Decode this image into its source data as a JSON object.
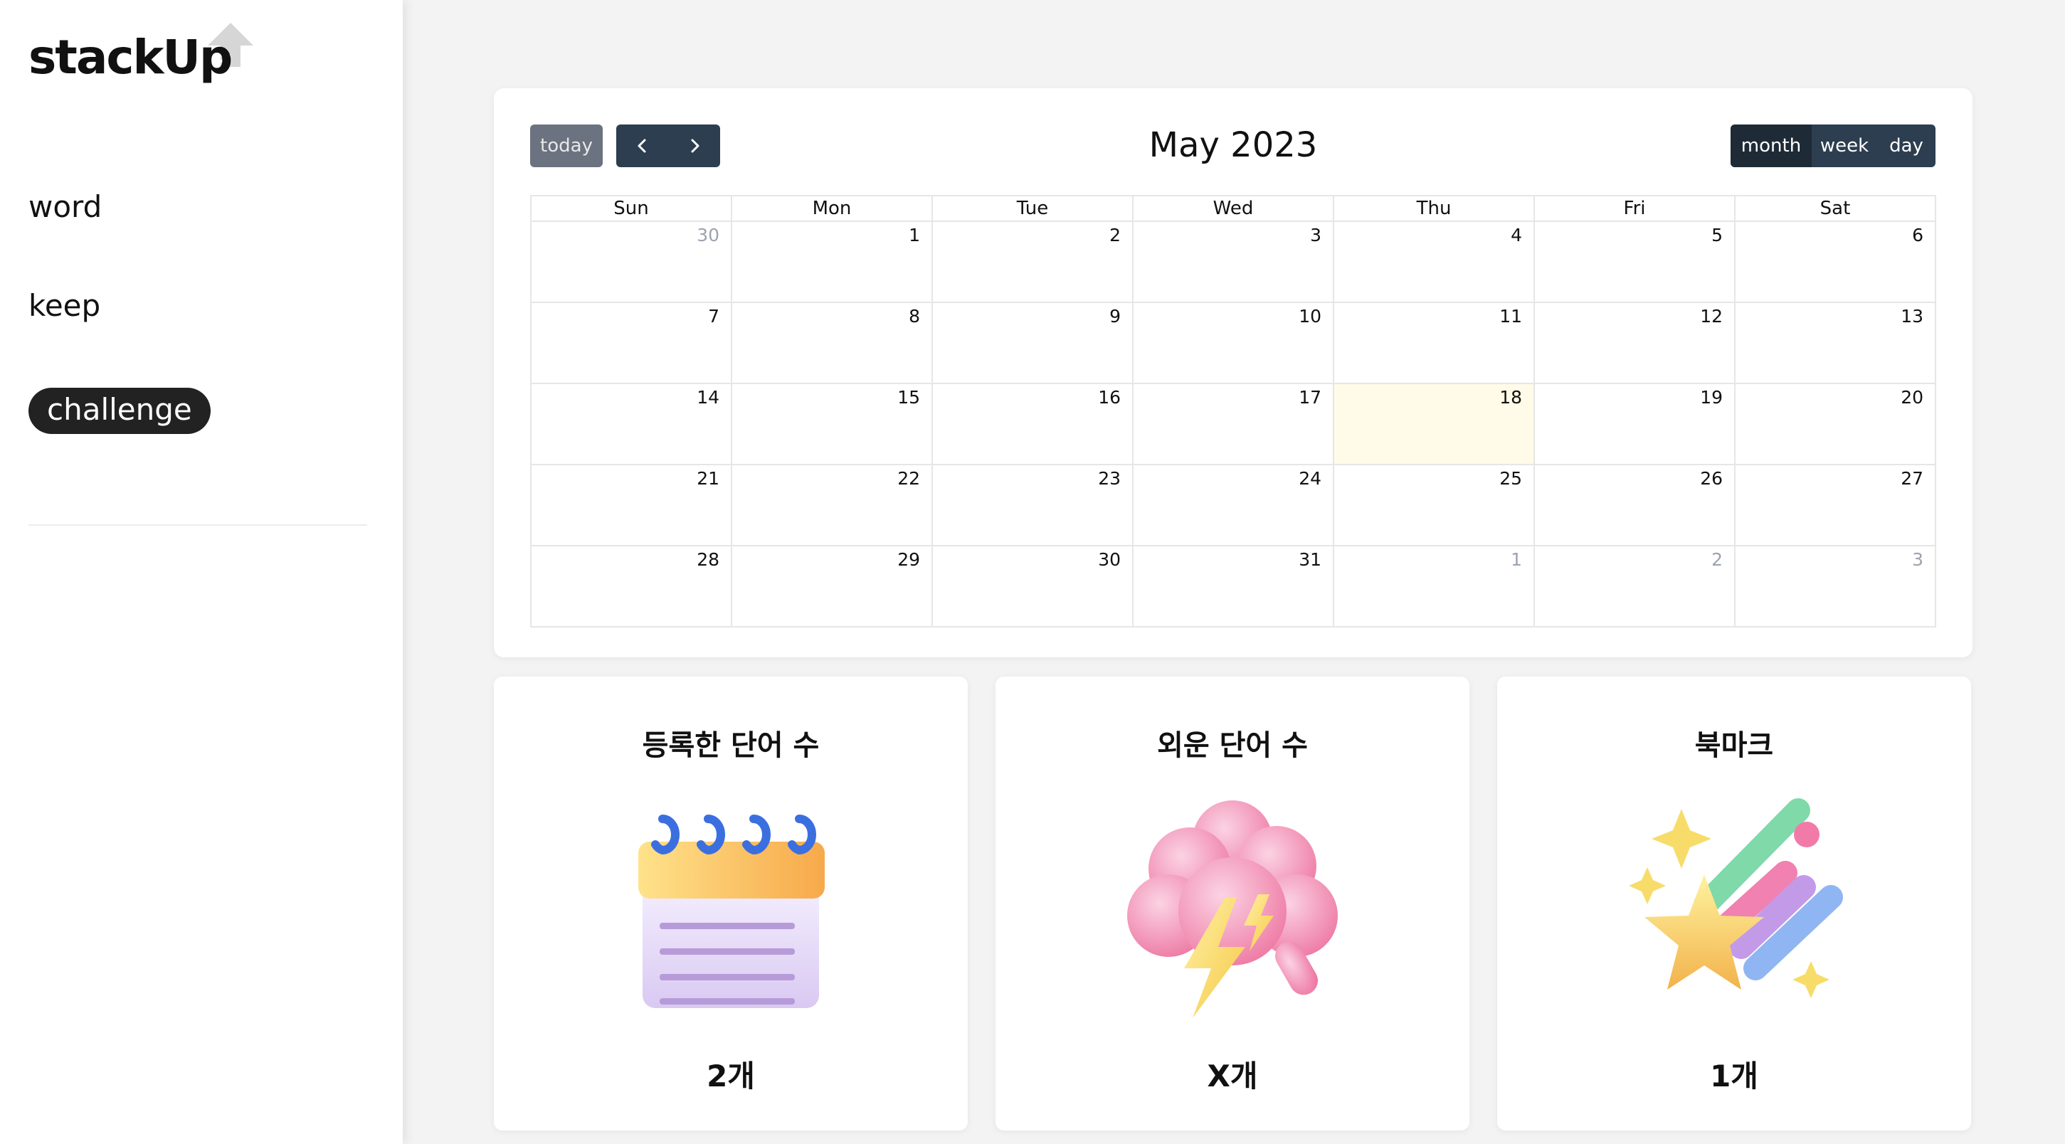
{
  "app": {
    "logo_text": "stackUp"
  },
  "sidebar": {
    "items": [
      {
        "label": "word"
      },
      {
        "label": "keep"
      },
      {
        "label": "challenge",
        "active": true
      }
    ]
  },
  "calendar": {
    "title": "May 2023",
    "today_label": "today",
    "views": [
      "month",
      "week",
      "day"
    ],
    "active_view": "month",
    "weekdays": [
      "Sun",
      "Mon",
      "Tue",
      "Wed",
      "Thu",
      "Fri",
      "Sat"
    ],
    "weeks": [
      [
        {
          "d": "30",
          "other": true
        },
        {
          "d": "1"
        },
        {
          "d": "2"
        },
        {
          "d": "3"
        },
        {
          "d": "4"
        },
        {
          "d": "5"
        },
        {
          "d": "6"
        }
      ],
      [
        {
          "d": "7"
        },
        {
          "d": "8"
        },
        {
          "d": "9"
        },
        {
          "d": "10"
        },
        {
          "d": "11"
        },
        {
          "d": "12"
        },
        {
          "d": "13"
        }
      ],
      [
        {
          "d": "14"
        },
        {
          "d": "15"
        },
        {
          "d": "16"
        },
        {
          "d": "17"
        },
        {
          "d": "18",
          "today": true
        },
        {
          "d": "19"
        },
        {
          "d": "20"
        }
      ],
      [
        {
          "d": "21"
        },
        {
          "d": "22"
        },
        {
          "d": "23"
        },
        {
          "d": "24"
        },
        {
          "d": "25"
        },
        {
          "d": "26"
        },
        {
          "d": "27"
        }
      ],
      [
        {
          "d": "28"
        },
        {
          "d": "29"
        },
        {
          "d": "30"
        },
        {
          "d": "31"
        },
        {
          "d": "1",
          "other": true
        },
        {
          "d": "2",
          "other": true
        },
        {
          "d": "3",
          "other": true
        }
      ]
    ],
    "today_highlight_color": "#fffbe8"
  },
  "stats": [
    {
      "title": "등록한 단어 수",
      "value": "2개",
      "icon": "notepad-icon"
    },
    {
      "title": "외운 단어 수",
      "value": "X개",
      "icon": "brain-cloud-lightning-icon"
    },
    {
      "title": "북마크",
      "value": "1개",
      "icon": "shooting-star-icon"
    }
  ],
  "colors": {
    "accent_dark": "#2c3e50",
    "today_btn": "#6b7280"
  }
}
